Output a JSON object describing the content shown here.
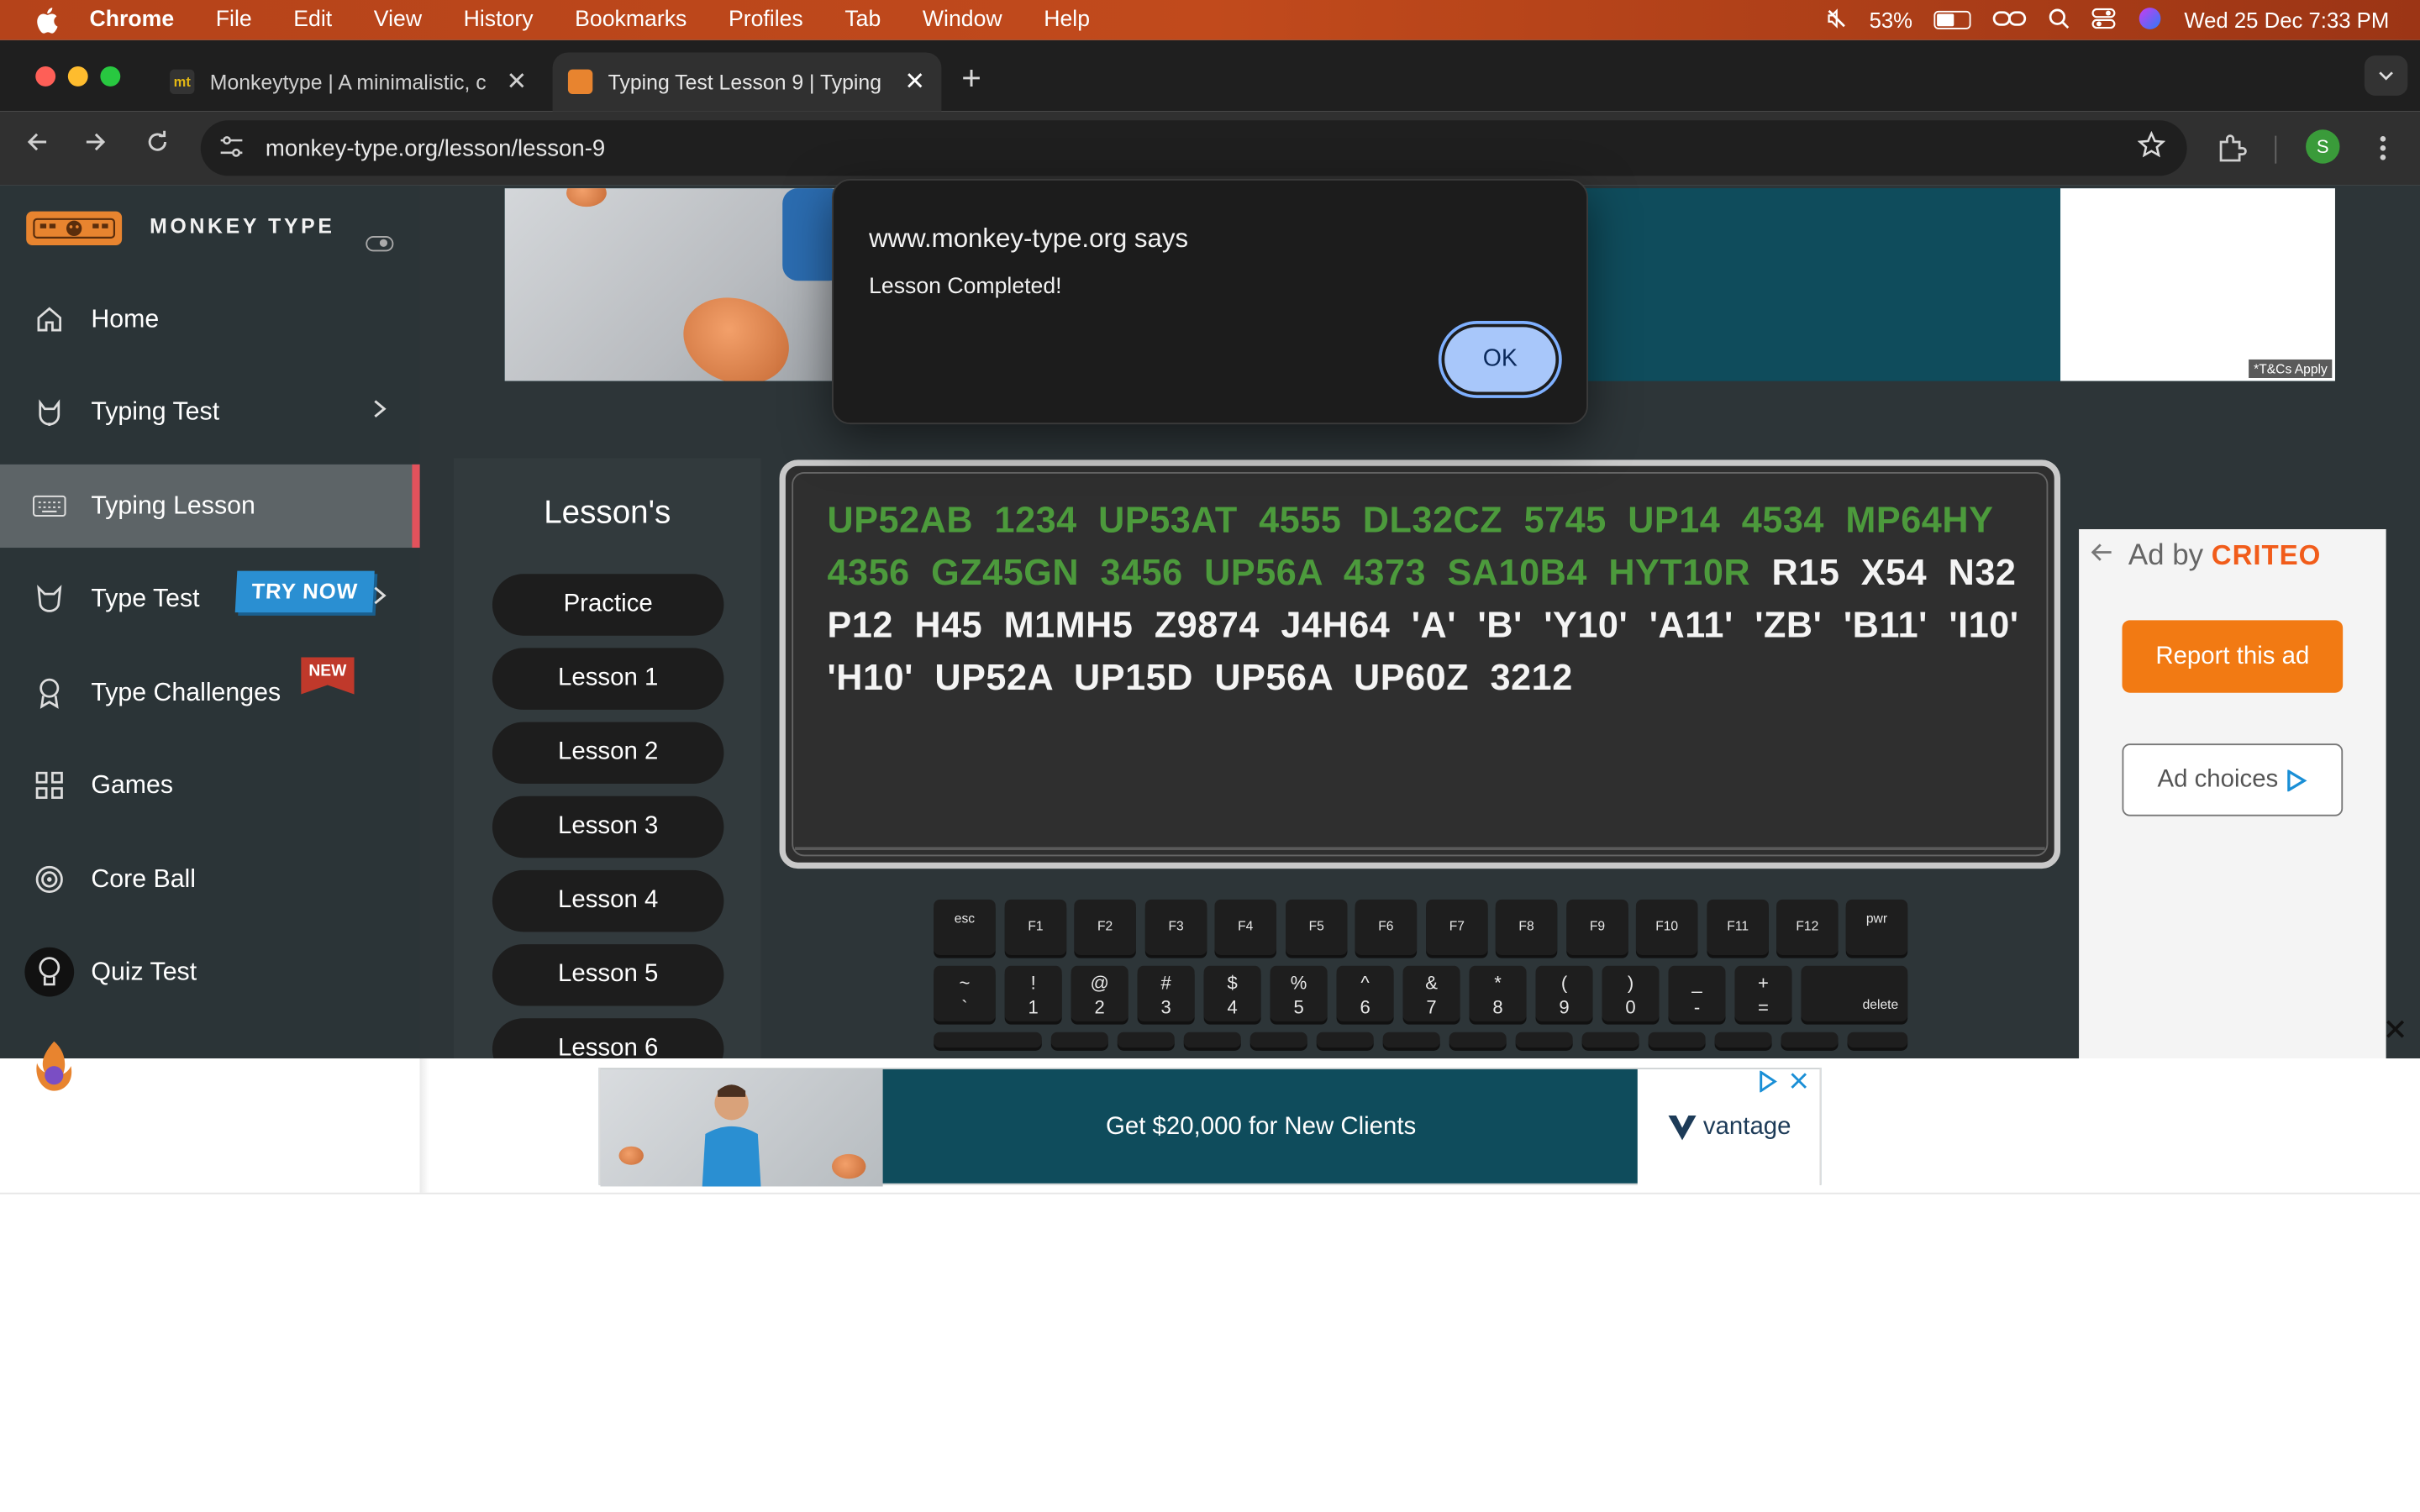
{
  "menubar": {
    "app": "Chrome",
    "items": [
      "File",
      "Edit",
      "View",
      "History",
      "Bookmarks",
      "Profiles",
      "Tab",
      "Window",
      "Help"
    ],
    "battery_pct": "53%",
    "battery_level": 0.53,
    "datetime": "Wed 25 Dec  7:33 PM"
  },
  "tabs": [
    {
      "favicon": "mt",
      "title": "Monkeytype | A minimalistic, c",
      "close": "✕"
    },
    {
      "favicon": "",
      "title": "Typing Test Lesson 9 | Typing",
      "close": "✕"
    }
  ],
  "newtab": "+",
  "address": {
    "url": "monkey-type.org/lesson/lesson-9"
  },
  "profile_initial": "S",
  "sidebar": {
    "brand": "MONKEY TYPE",
    "items": [
      {
        "label": "Home"
      },
      {
        "label": "Typing Test"
      },
      {
        "label": "Typing Lesson"
      },
      {
        "label": "Type Test",
        "badge": "TRY NOW"
      },
      {
        "label": "Type Challenges",
        "badge": "NEW"
      },
      {
        "label": "Games"
      },
      {
        "label": "Core Ball"
      },
      {
        "label": "Quiz Test"
      }
    ]
  },
  "top_ad": {
    "tcs": "*T&Cs Apply"
  },
  "lessons": {
    "title": "Lesson's",
    "buttons": [
      "Practice",
      "Lesson 1",
      "Lesson 2",
      "Lesson 3",
      "Lesson 4",
      "Lesson 5",
      "Lesson 6"
    ]
  },
  "typing": {
    "completed_text": "UP52AB 1234 UP53AT 4555 DL32CZ 5745 UP14 4534 MP64HY 4356 GZ45GN 3456 UP56A 4373 SA10B4 HYT10R",
    "remaining_text": " R15 X54 N32 P12 H45 M1MH5 Z9874 J4H64 'A' 'B' 'Y10' 'A11' 'ZB' 'B11' 'I10' 'H10' UP52A UP15D UP56A UP60Z 3212"
  },
  "keyboard": {
    "fn_row": [
      "esc",
      "F1",
      "F2",
      "F3",
      "F4",
      "F5",
      "F6",
      "F7",
      "F8",
      "F9",
      "F10",
      "F11",
      "F12",
      "pwr"
    ],
    "num_row": [
      {
        "top": "~",
        "bottom": "`"
      },
      {
        "top": "!",
        "bottom": "1"
      },
      {
        "top": "@",
        "bottom": "2"
      },
      {
        "top": "#",
        "bottom": "3"
      },
      {
        "top": "$",
        "bottom": "4"
      },
      {
        "top": "%",
        "bottom": "5"
      },
      {
        "top": "^",
        "bottom": "6"
      },
      {
        "top": "&",
        "bottom": "7"
      },
      {
        "top": "*",
        "bottom": "8"
      },
      {
        "top": "(",
        "bottom": "9"
      },
      {
        "top": ")",
        "bottom": "0"
      },
      {
        "top": "_",
        "bottom": "-"
      },
      {
        "top": "+",
        "bottom": "="
      }
    ],
    "delete": "delete"
  },
  "right_ad": {
    "adby": "Ad by",
    "brand": "CRITEO",
    "report": "Report this ad",
    "choices": "Ad choices"
  },
  "dialog": {
    "title": "www.monkey-type.org says",
    "message": "Lesson Completed!",
    "ok": "OK"
  },
  "bottom_ad": {
    "headline": "Get $20,000 for New Clients",
    "brand": "vantage"
  },
  "colors": {
    "completed": "#4c9a3c",
    "accent_orange": "#f27a13",
    "active_marker": "#e2525c"
  }
}
